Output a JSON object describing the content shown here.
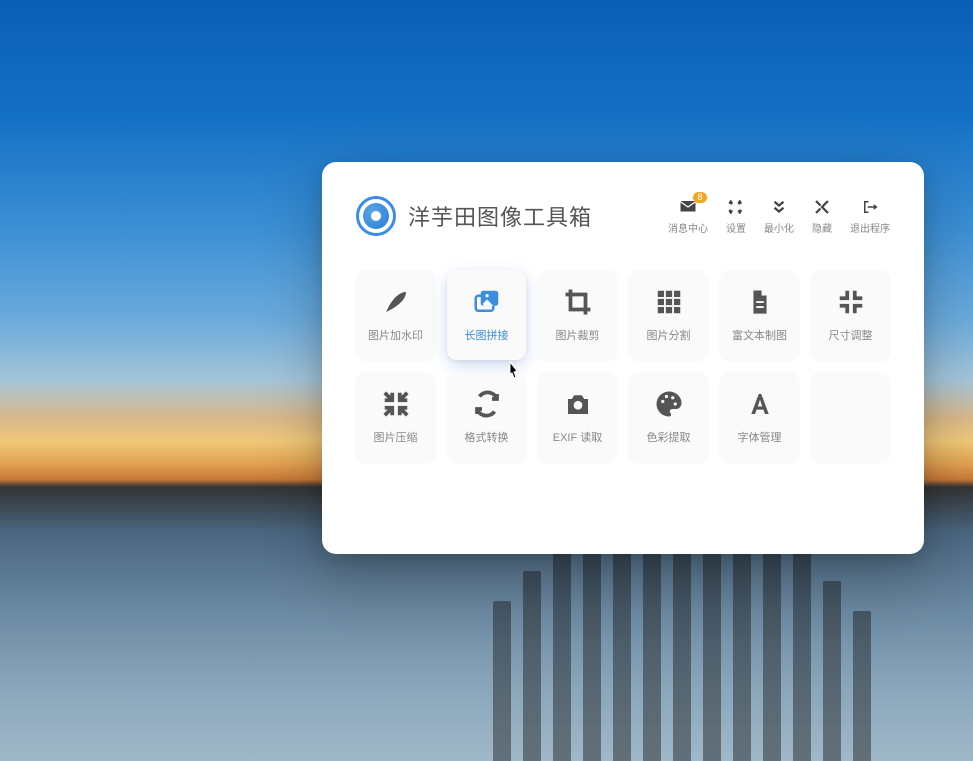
{
  "app": {
    "title": "洋芋田图像工具箱"
  },
  "toolbar": {
    "items": [
      {
        "label": "消息中心",
        "badge": "8"
      },
      {
        "label": "设置"
      },
      {
        "label": "最小化"
      },
      {
        "label": "隐藏"
      },
      {
        "label": "退出程序"
      }
    ]
  },
  "tiles": {
    "row1": [
      {
        "label": "图片加水印"
      },
      {
        "label": "长图拼接"
      },
      {
        "label": "图片裁剪"
      },
      {
        "label": "图片分割"
      },
      {
        "label": "富文本制图"
      },
      {
        "label": "尺寸调整"
      }
    ],
    "row2": [
      {
        "label": "图片压缩"
      },
      {
        "label": "格式转换"
      },
      {
        "label": "EXIF 读取"
      },
      {
        "label": "色彩提取"
      },
      {
        "label": "字体管理"
      }
    ]
  }
}
